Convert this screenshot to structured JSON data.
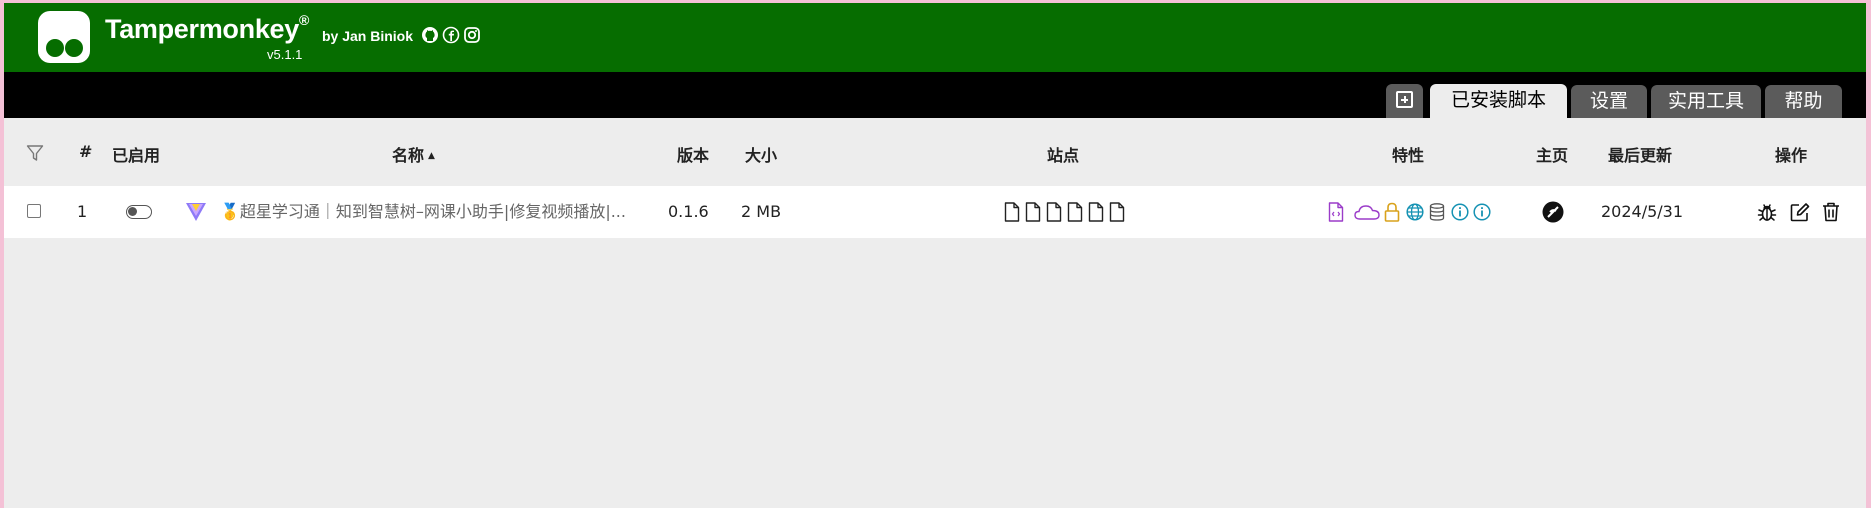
{
  "header": {
    "app_name": "Tampermonkey",
    "registered_mark": "®",
    "author": "by Jan Biniok",
    "version": "v5.1.1",
    "social_icons": [
      "github-icon",
      "facebook-icon",
      "instagram-icon"
    ],
    "bg_color": "#066d00"
  },
  "tabs": {
    "add_icon": "plus-square-icon",
    "items": [
      {
        "label": "已安装脚本",
        "active": true
      },
      {
        "label": "设置",
        "active": false
      },
      {
        "label": "实用工具",
        "active": false
      },
      {
        "label": "帮助",
        "active": false
      }
    ]
  },
  "table": {
    "columns": {
      "number": "#",
      "enabled": "已启用",
      "name": "名称",
      "version": "版本",
      "size": "大小",
      "sites": "站点",
      "features": "特性",
      "homepage": "主页",
      "last_updated": "最后更新",
      "actions": "操作"
    },
    "sort_indicator": "▲",
    "rows": [
      {
        "number": "1",
        "enabled": false,
        "name": "🥇超星学习通｜知到智慧树–网课小助手|修复视频播放|...",
        "version": "0.1.6",
        "size": "2 MB",
        "sites_icons": [
          "file-icon",
          "file-icon",
          "file-icon",
          "file-icon",
          "file-icon",
          "file-icon"
        ],
        "feature_icons": [
          "code-file-icon",
          "cloud-icon",
          "lock-icon",
          "globe-icon",
          "database-icon",
          "info-icon",
          "info-icon"
        ],
        "homepage_icon": "homepage-icon",
        "last_updated": "2024/5/31",
        "action_icons": [
          "bug-icon",
          "edit-icon",
          "trash-icon"
        ]
      }
    ]
  }
}
